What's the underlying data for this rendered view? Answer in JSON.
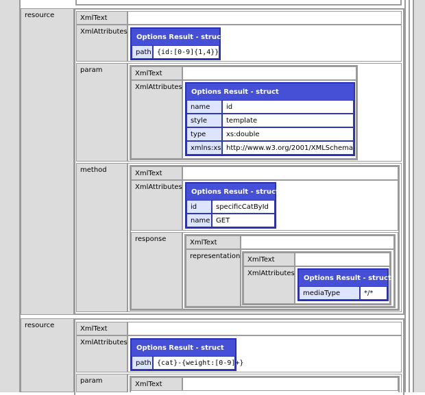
{
  "struct_title": "Options Result - struct",
  "labels": {
    "resource": "resource",
    "xmltext": "XmlText",
    "xmlattributes": "XmlAttributes",
    "param": "param",
    "method": "method",
    "response": "response",
    "representation": "representation"
  },
  "resource1": {
    "path_key": "path",
    "path_value": "{id:[0-9]{1,4}}",
    "param": {
      "rows": [
        {
          "key": "name",
          "value": "id"
        },
        {
          "key": "style",
          "value": "template"
        },
        {
          "key": "type",
          "value": "xs:double"
        },
        {
          "key": "xmlns:xs",
          "value": "http://www.w3.org/2001/XMLSchema"
        }
      ]
    },
    "method": {
      "rows": [
        {
          "key": "id",
          "value": "specificCatById"
        },
        {
          "key": "name",
          "value": "GET"
        }
      ],
      "representation": {
        "key": "mediaType",
        "value": "*/*"
      }
    }
  },
  "resource2": {
    "path_key": "path",
    "path_value": "{cat}-{weight:[0-9]+}"
  },
  "colors": {
    "struct_header": "#4550d6",
    "struct_border": "#2a2fb7",
    "key_cell": "#dde4ff",
    "label_cell": "#dcdcdc",
    "frame_border": "#9a9a9a"
  }
}
